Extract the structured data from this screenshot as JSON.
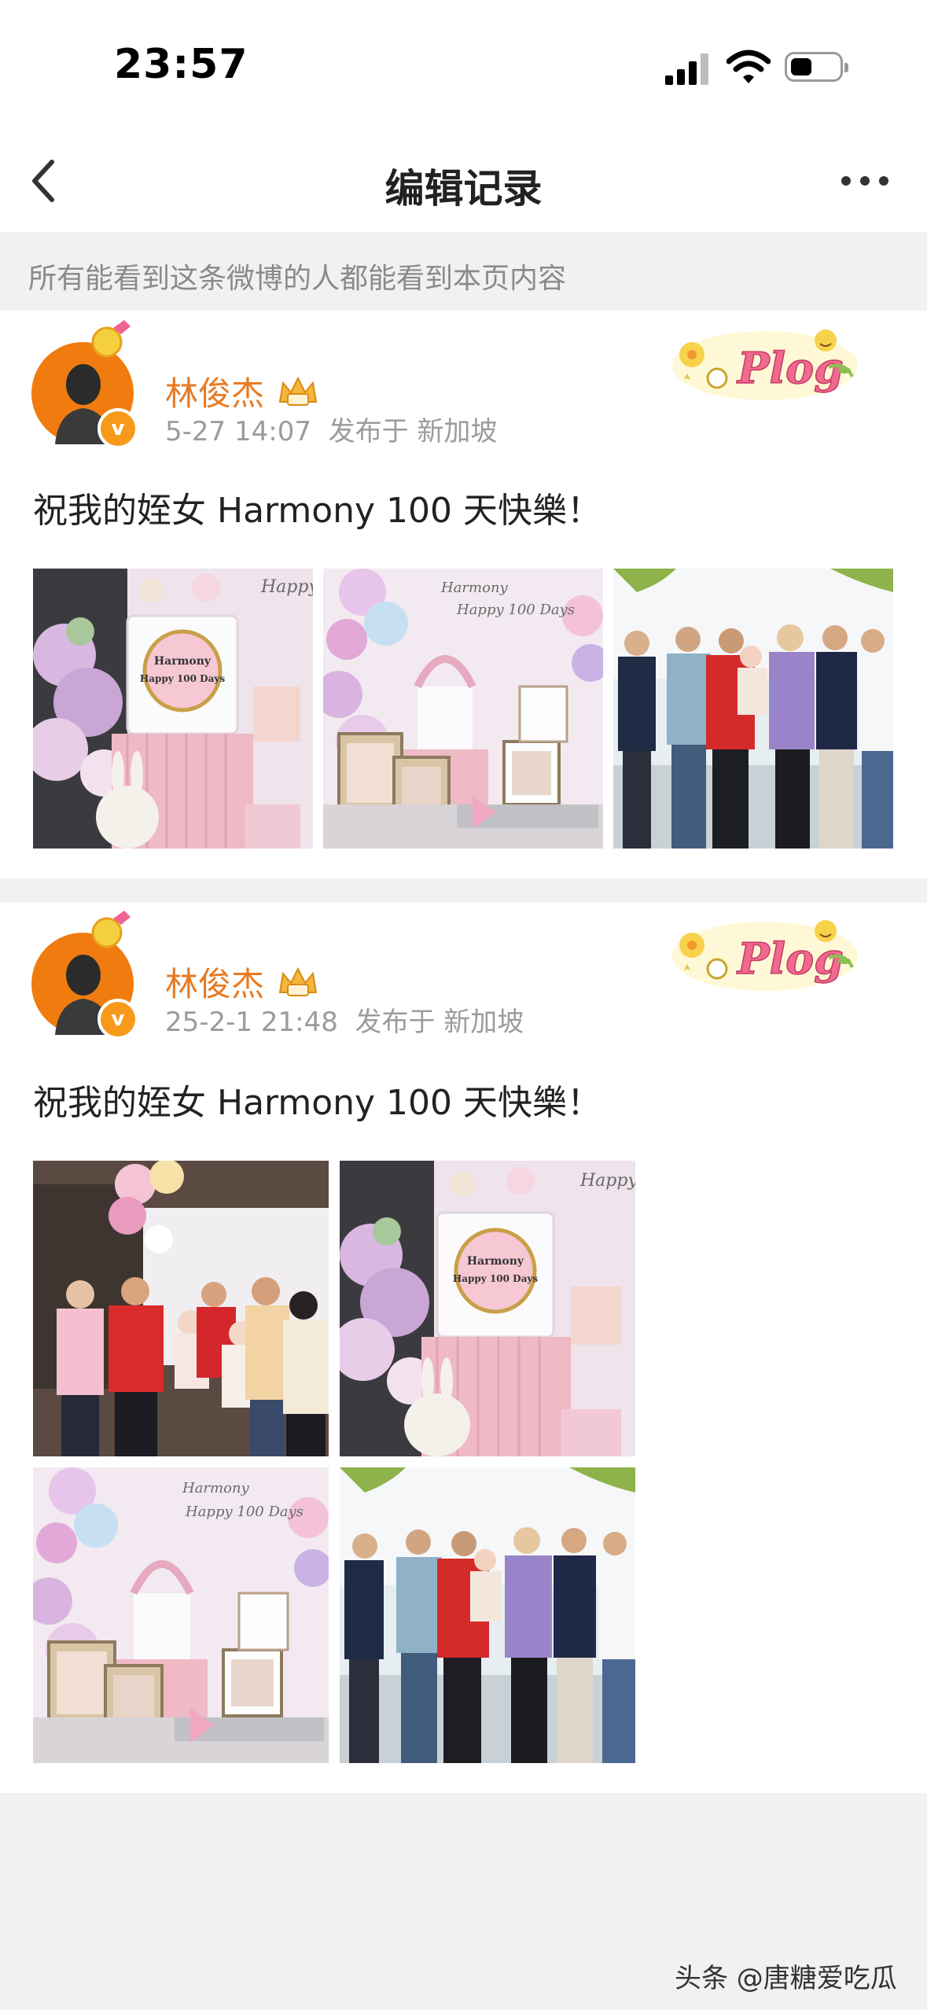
{
  "status_bar": {
    "time": "23:57"
  },
  "nav": {
    "title": "编辑记录"
  },
  "notice": {
    "text": "所有能看到这条微博的人都能看到本页内容"
  },
  "posts": [
    {
      "user_name": "林俊杰",
      "timestamp": "5-27 14:07",
      "location_label": "发布于 新加坡",
      "text": "祝我的姪女 Harmony 100 天快樂！",
      "cake_text": [
        "Harmony",
        "Happy 100 Days"
      ],
      "sticker_text": "Plog"
    },
    {
      "user_name": "林俊杰",
      "timestamp": "25-2-1 21:48",
      "location_label": "发布于 新加坡",
      "text": "祝我的姪女 Harmony 100 天快樂！",
      "cake_text": [
        "Harmony",
        "Happy 100 Days"
      ],
      "sticker_text": "Plog"
    }
  ],
  "watermark": {
    "text": "头条 @唐糖爱吃瓜"
  },
  "colors": {
    "username": "#e87a21",
    "avatar": "#f07c10",
    "page_bg": "#f1f1f3",
    "meta": "#9b9b9b"
  }
}
